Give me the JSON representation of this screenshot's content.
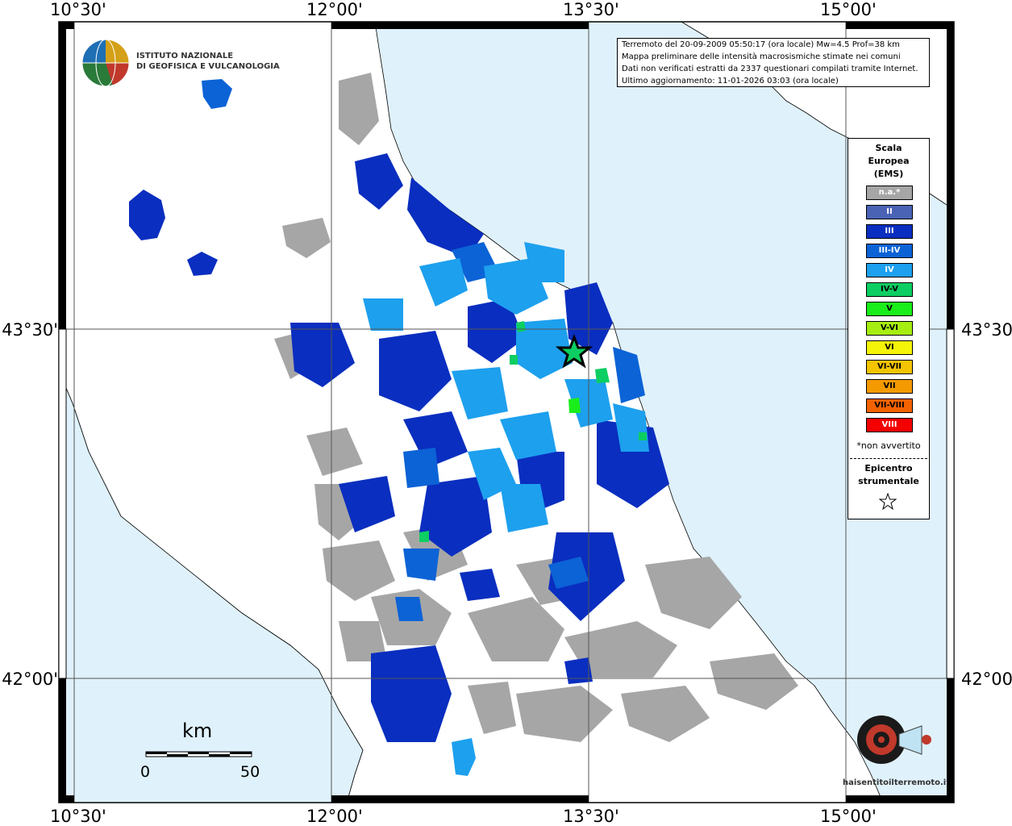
{
  "axis_labels": {
    "lon": [
      "10°30'",
      "12°00'",
      "13°30'",
      "15°00'"
    ],
    "lat": [
      "43°30'",
      "42°00'"
    ]
  },
  "logo": {
    "line1": "ISTITUTO NAZIONALE",
    "line2": "DI GEOFISICA E VULCANOLOGIA"
  },
  "info": {
    "line1": "Terremoto del 20-09-2009 05:50:17 (ora locale) Mw=4.5 Prof=38 km",
    "line2": "Mappa preliminare delle intensità macrosismiche stimate nei comuni",
    "line3": "Dati non verificati estratti da 2337 questionari compilati tramite Internet.",
    "line4": "Ultimo aggiornamento: 11-01-2026 03:03 (ora locale)"
  },
  "legend": {
    "title": "Scala Europea (EMS)",
    "items": [
      {
        "label": "n.a.*",
        "color": "#a6a6a6",
        "text_color": "#ffffff"
      },
      {
        "label": "II",
        "color": "#4a63b5",
        "text_color": "#ffffff"
      },
      {
        "label": "III",
        "color": "#0a2ebf",
        "text_color": "#ffffff"
      },
      {
        "label": "III-IV",
        "color": "#0c63d6",
        "text_color": "#ffffff"
      },
      {
        "label": "IV",
        "color": "#1da0ee",
        "text_color": "#ffffff"
      },
      {
        "label": "IV-V",
        "color": "#0cce62",
        "text_color": "#000000"
      },
      {
        "label": "V",
        "color": "#1aee1a",
        "text_color": "#000000"
      },
      {
        "label": "V-VI",
        "color": "#a6ee12",
        "text_color": "#000000"
      },
      {
        "label": "VI",
        "color": "#f4f408",
        "text_color": "#000000"
      },
      {
        "label": "VI-VII",
        "color": "#f4c400",
        "text_color": "#000000"
      },
      {
        "label": "VII",
        "color": "#f49a00",
        "text_color": "#000000"
      },
      {
        "label": "VII-VIII",
        "color": "#f46200",
        "text_color": "#000000"
      },
      {
        "label": "VIII",
        "color": "#f40000",
        "text_color": "#ffffff"
      }
    ],
    "note": "*non avvertito",
    "epicenter_label": "Epicentro strumentale"
  },
  "scale_bar": {
    "unit": "km",
    "start": "0",
    "end": "50"
  },
  "badge": {
    "text": "haisentitoilterremoto.it"
  },
  "colors": {
    "sea": "#dff1fb",
    "land": "#ffffff",
    "frame": "#000000"
  }
}
